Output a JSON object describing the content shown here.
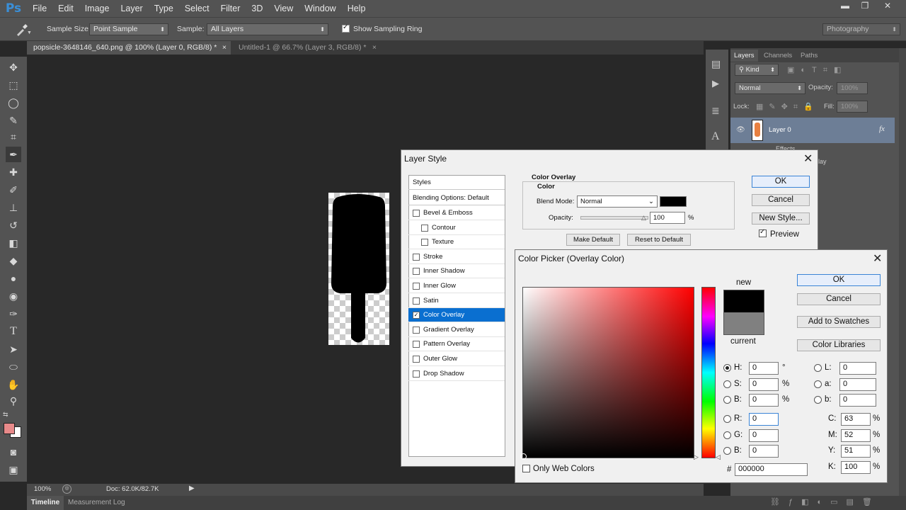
{
  "app": {
    "logo": "Ps"
  },
  "menu": [
    "File",
    "Edit",
    "Image",
    "Layer",
    "Type",
    "Select",
    "Filter",
    "3D",
    "View",
    "Window",
    "Help"
  ],
  "window_controls": {
    "minimize": "▬",
    "restore": "❐",
    "close": "✕"
  },
  "options": {
    "sample_size_label": "Sample Size:",
    "sample_size_value": "Point Sample",
    "sample_label": "Sample:",
    "sample_value": "All Layers",
    "sampling_ring_label": "Show Sampling Ring",
    "workspace": "Photography"
  },
  "doc_tabs": [
    {
      "label": "popsicle-3648146_640.png @ 100% (Layer 0, RGB/8) *",
      "close": "×"
    },
    {
      "label": "Untitled-1 @ 66.7% (Layer 3, RGB/8) *",
      "close": "×"
    }
  ],
  "status": {
    "zoom": "100%",
    "doc": "Doc: 62.0K/82.7K"
  },
  "timeline_tabs": [
    "Timeline",
    "Measurement Log"
  ],
  "layers_panel": {
    "tabs": [
      "Layers",
      "Channels",
      "Paths"
    ],
    "filter": "Kind",
    "blend": "Normal",
    "opacity_label": "Opacity:",
    "opacity_value": "100%",
    "lock_label": "Lock:",
    "fill_label": "Fill:",
    "fill_value": "100%",
    "layer_name": "Layer 0",
    "fx": "fx",
    "effects_label": "Effects",
    "effect_partial": "lay"
  },
  "layer_style": {
    "title": "Layer Style",
    "styles_header": "Styles",
    "blending_options": "Blending Options: Default",
    "styles": [
      {
        "label": "Bevel & Emboss",
        "checked": false,
        "indent": false,
        "selected": false
      },
      {
        "label": "Contour",
        "checked": false,
        "indent": true,
        "selected": false
      },
      {
        "label": "Texture",
        "checked": false,
        "indent": true,
        "selected": false
      },
      {
        "label": "Stroke",
        "checked": false,
        "indent": false,
        "selected": false
      },
      {
        "label": "Inner Shadow",
        "checked": false,
        "indent": false,
        "selected": false
      },
      {
        "label": "Inner Glow",
        "checked": false,
        "indent": false,
        "selected": false
      },
      {
        "label": "Satin",
        "checked": false,
        "indent": false,
        "selected": false
      },
      {
        "label": "Color Overlay",
        "checked": true,
        "indent": false,
        "selected": true
      },
      {
        "label": "Gradient Overlay",
        "checked": false,
        "indent": false,
        "selected": false
      },
      {
        "label": "Pattern Overlay",
        "checked": false,
        "indent": false,
        "selected": false
      },
      {
        "label": "Outer Glow",
        "checked": false,
        "indent": false,
        "selected": false
      },
      {
        "label": "Drop Shadow",
        "checked": false,
        "indent": false,
        "selected": false
      }
    ],
    "section_title": "Color Overlay",
    "subsection_title": "Color",
    "blend_mode_label": "Blend Mode:",
    "blend_mode_value": "Normal",
    "opacity_label": "Opacity:",
    "opacity_value": "100",
    "opacity_unit": "%",
    "make_default": "Make Default",
    "reset_default": "Reset to Default",
    "ok": "OK",
    "cancel": "Cancel",
    "new_style": "New Style...",
    "preview": "Preview",
    "swatch_color": "#000000"
  },
  "color_picker": {
    "title": "Color Picker (Overlay Color)",
    "ok": "OK",
    "cancel": "Cancel",
    "add_swatches": "Add to Swatches",
    "color_libraries": "Color Libraries",
    "new_label": "new",
    "current_label": "current",
    "new_color": "#000000",
    "current_color": "#808080",
    "hue_color": "#ff0000",
    "only_web_colors": "Only Web Colors",
    "hsb": [
      {
        "key": "H:",
        "value": "0",
        "unit": "°",
        "selected": true
      },
      {
        "key": "S:",
        "value": "0",
        "unit": "%",
        "selected": false
      },
      {
        "key": "B:",
        "value": "0",
        "unit": "%",
        "selected": false
      }
    ],
    "rgb": [
      {
        "key": "R:",
        "value": "0"
      },
      {
        "key": "G:",
        "value": "0"
      },
      {
        "key": "B:",
        "value": "0"
      }
    ],
    "lab": [
      {
        "key": "L:",
        "value": "0"
      },
      {
        "key": "a:",
        "value": "0"
      },
      {
        "key": "b:",
        "value": "0"
      }
    ],
    "cmyk": [
      {
        "key": "C:",
        "value": "63",
        "unit": "%"
      },
      {
        "key": "M:",
        "value": "52",
        "unit": "%"
      },
      {
        "key": "Y:",
        "value": "51",
        "unit": "%"
      },
      {
        "key": "K:",
        "value": "100",
        "unit": "%"
      }
    ],
    "hex_label": "#",
    "hex_value": "000000"
  },
  "colors": {
    "foreground": "#e88a8a",
    "background": "#ffffff",
    "selection": "#0a6fd0",
    "ps_blue": "#3a8fd8"
  }
}
